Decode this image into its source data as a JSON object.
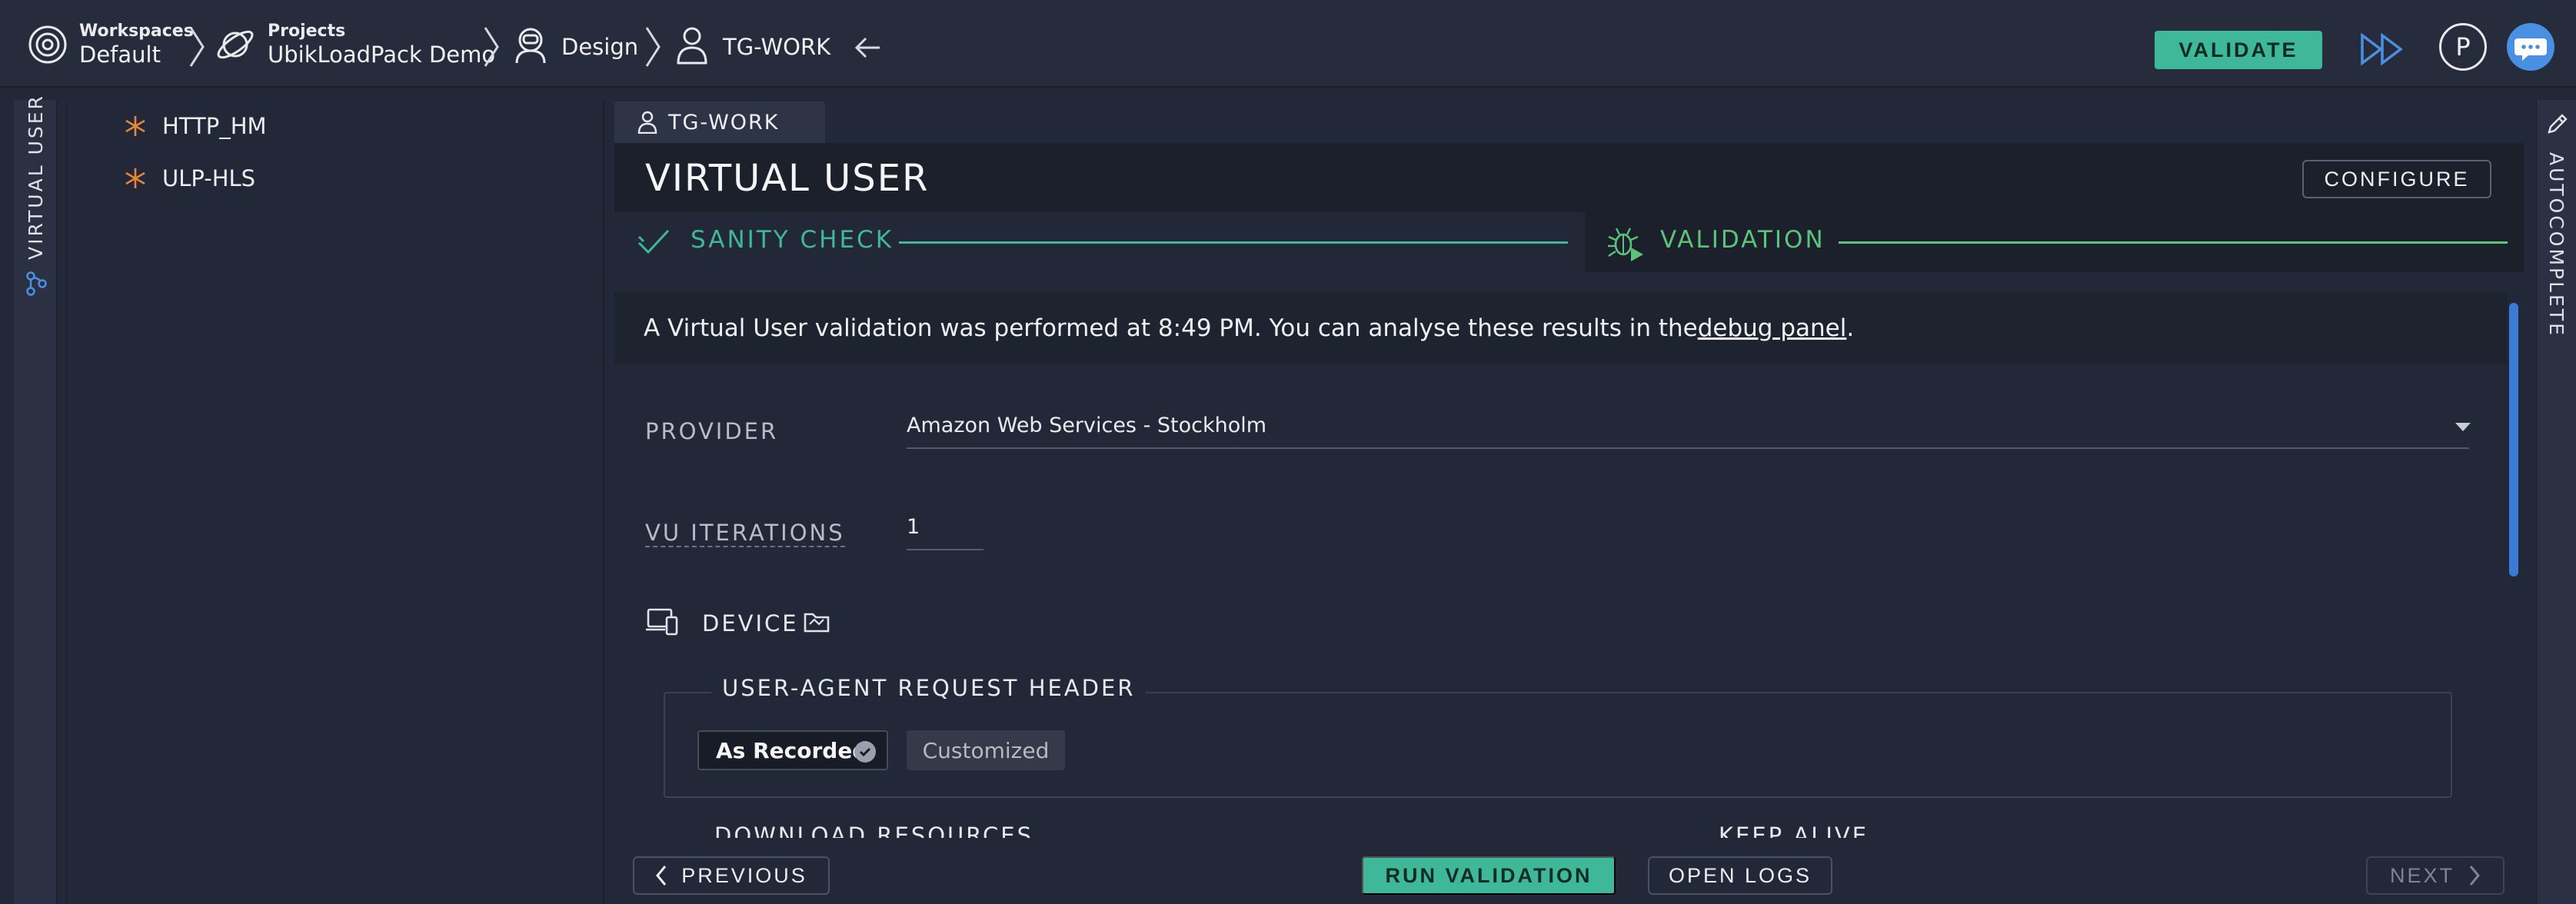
{
  "breadcrumb": {
    "workspaces_label": "Workspaces",
    "workspace_name": "Default",
    "projects_label": "Projects",
    "project_name": "UbikLoadPack Demo",
    "design_label": "Design",
    "user_label": "TG-WORK"
  },
  "header": {
    "validate_label": "VALIDATE",
    "profile_initial": "P"
  },
  "left_rail": {
    "label": "VIRTUAL USER"
  },
  "tree": {
    "items": [
      {
        "label": "HTTP_HM"
      },
      {
        "label": "ULP-HLS"
      }
    ]
  },
  "main": {
    "tab_label": "TG-WORK",
    "title": "VIRTUAL USER",
    "configure_label": "CONFIGURE",
    "steps": [
      {
        "label": "SANITY CHECK"
      },
      {
        "label": "VALIDATION"
      }
    ],
    "notice_text": "A Virtual User validation was performed at 8:49 PM. You can analyse these results in the ",
    "notice_link": "debug panel",
    "notice_end": ".",
    "provider_label": "PROVIDER",
    "provider_value": "Amazon Web Services - Stockholm",
    "vu_iterations_label": "VU ITERATIONS",
    "vu_iterations_value": "1",
    "device_label": "DEVICE",
    "ua_header_label": "USER-AGENT REQUEST HEADER",
    "ua_options": [
      "As Recorded",
      "Customized"
    ],
    "download_resources_label": "DOWNLOAD RESOURCES",
    "keep_alive_label": "KEEP ALIVE"
  },
  "footer": {
    "previous_label": "PREVIOUS",
    "run_validation_label": "RUN VALIDATION",
    "open_logs_label": "OPEN LOGS",
    "next_label": "NEXT"
  },
  "right_rail": {
    "label": "AUTOCOMPLETE"
  },
  "colors": {
    "accent_teal": "#3fb89a",
    "validation_green": "#5cc47a",
    "star_orange": "#e7873a",
    "scroll_blue": "#3b7bd8"
  },
  "icons": [
    "workspace-icon",
    "project-icon",
    "design-icon",
    "user-icon",
    "back-arrow-icon",
    "fast-forward-icon",
    "chat-icon",
    "star-icon",
    "check-icon",
    "bug-icon",
    "device-icon",
    "folder-icon",
    "chevron-left-icon",
    "chevron-right-icon",
    "pen-icon",
    "tree-icon"
  ]
}
